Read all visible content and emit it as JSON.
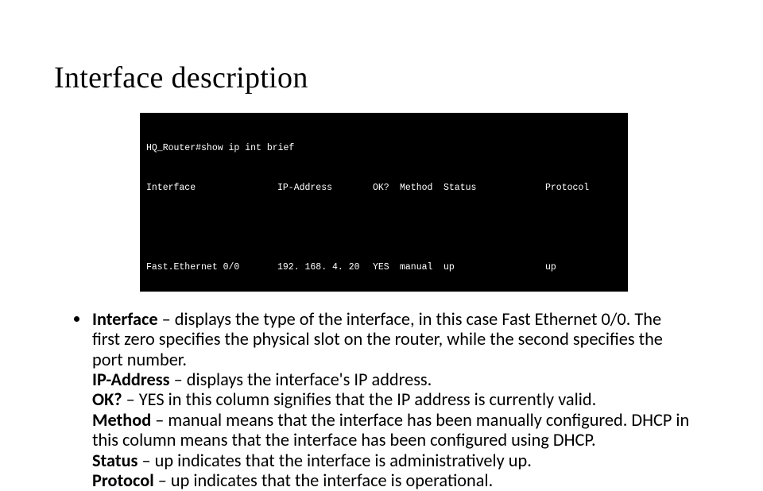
{
  "title": "Interface description",
  "terminal": {
    "prompt": "HQ_Router#",
    "command": "show ip int brief",
    "headers": {
      "interface": "Interface",
      "ip": "IP-Address",
      "ok": "OK?",
      "method": "Method",
      "status": "Status",
      "protocol": "Protocol"
    },
    "row": {
      "interface": "Fast.Ethernet 0/0",
      "ip": "192. 168. 4. 20",
      "ok": "YES",
      "method": "manual",
      "status": "up",
      "protocol": "up"
    }
  },
  "definitions": [
    {
      "term": "Interface",
      "desc": " – displays the type of the interface, in this case Fast Ethernet 0/0. The first zero specifies the physical slot on the router, while the second specifies the port number."
    },
    {
      "term": "IP-Address",
      "desc": " – displays the interface's IP address."
    },
    {
      "term": "OK?",
      "desc": " – YES in this column signifies that the IP address is currently valid."
    },
    {
      "term": "Method",
      "desc": " – manual means that the interface has been manually configured. DHCP in this column means that the interface has been configured using DHCP."
    },
    {
      "term": "Status",
      "desc": " – up indicates that the interface is administratively up."
    },
    {
      "term": "Protocol",
      "desc": " – up indicates that the interface is operational."
    }
  ]
}
